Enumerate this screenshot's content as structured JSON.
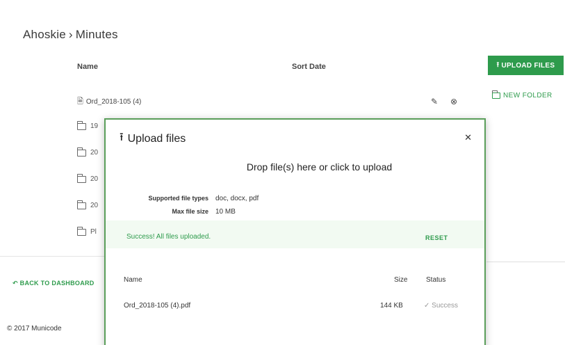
{
  "breadcrumb": {
    "parent": "Ahoskie",
    "separator": "›",
    "current": "Minutes"
  },
  "table": {
    "name_header": "Name",
    "sort_date_header": "Sort Date"
  },
  "actions": {
    "upload_label": "UPLOAD FILES",
    "new_folder_label": "NEW FOLDER"
  },
  "files": [
    {
      "name": "Ord_2018-105 (4)"
    }
  ],
  "folders": [
    {
      "name": "19"
    },
    {
      "name": "20"
    },
    {
      "name": "20"
    },
    {
      "name": "20"
    },
    {
      "name": "Pl"
    }
  ],
  "footer": {
    "back_label": "BACK TO DASHBOARD",
    "copyright": "© 2017 Municode"
  },
  "modal": {
    "title": "Upload files",
    "drop_text": "Drop file(s) here or click to upload",
    "supported_label": "Supported file types",
    "supported_value": "doc, docx, pdf",
    "max_label": "Max file size",
    "max_value": "10 MB",
    "success_text": "Success! All files uploaded.",
    "reset_label": "RESET",
    "columns": {
      "name": "Name",
      "size": "Size",
      "status": "Status"
    },
    "uploads": [
      {
        "name": "Ord_2018-105 (4).pdf",
        "size": "144 KB",
        "status": "Success"
      }
    ]
  },
  "colors": {
    "accent": "#2e9b4c",
    "modal_border": "#5a9e5a",
    "success_bg": "#f2faf2"
  }
}
